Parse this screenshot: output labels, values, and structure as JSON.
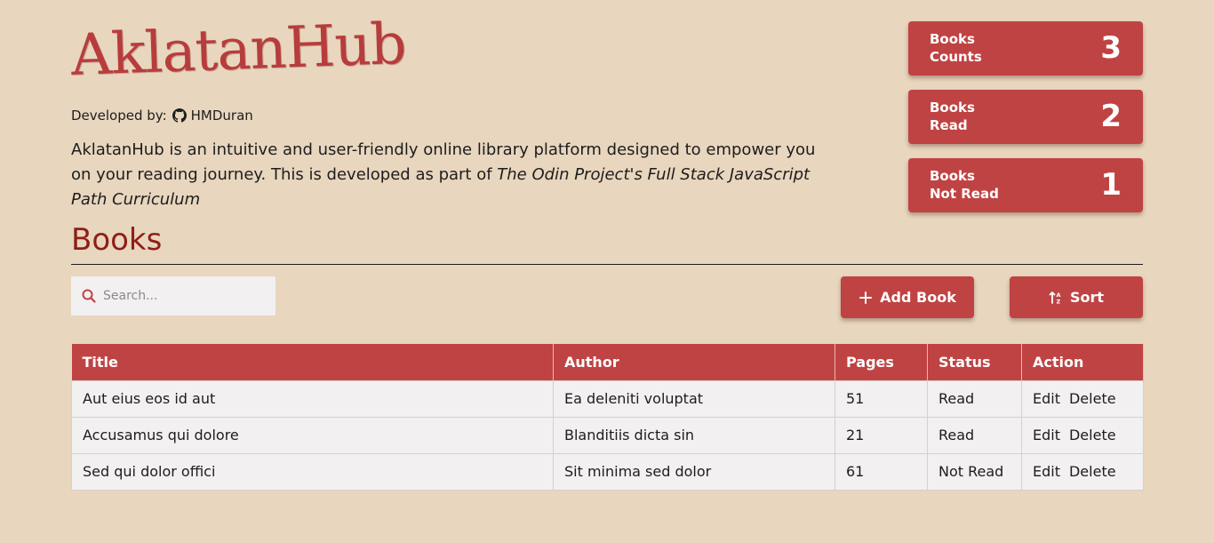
{
  "brand": {
    "logo": "AklatanHub",
    "developed_by_label": "Developed by:",
    "developer": "HMDuran",
    "description": "AklatanHub is an intuitive and user-friendly online library platform designed to empower you on your reading journey. This is developed as part of ",
    "description_italic": "The Odin Project's Full Stack JavaScript Path Curriculum"
  },
  "stats": [
    {
      "line1": "Books",
      "line2": "Counts",
      "value": "3"
    },
    {
      "line1": "Books",
      "line2": "Read",
      "value": "2"
    },
    {
      "line1": "Books",
      "line2": "Not Read",
      "value": "1"
    }
  ],
  "section": {
    "title": "Books"
  },
  "search": {
    "placeholder": "Search..."
  },
  "toolbar": {
    "add_label": "Add Book",
    "sort_label": "Sort"
  },
  "table": {
    "headers": [
      "Title",
      "Author",
      "Pages",
      "Status",
      "Action"
    ],
    "rows": [
      {
        "title": "Aut eius eos id aut",
        "author": "Ea deleniti voluptat",
        "pages": "51",
        "status": "Read"
      },
      {
        "title": "Accusamus qui dolore",
        "author": "Blanditiis dicta sin",
        "pages": "21",
        "status": "Read"
      },
      {
        "title": "Sed qui dolor offici",
        "author": "Sit minima sed dolor",
        "pages": "61",
        "status": "Not Read"
      }
    ],
    "edit_label": "Edit",
    "delete_label": "Delete"
  },
  "colors": {
    "background": "#e8d6be",
    "accent": "#c04343",
    "heading": "#8e1f16"
  },
  "icons": [
    "github-icon",
    "search-icon",
    "plus-icon",
    "sort-icon"
  ]
}
